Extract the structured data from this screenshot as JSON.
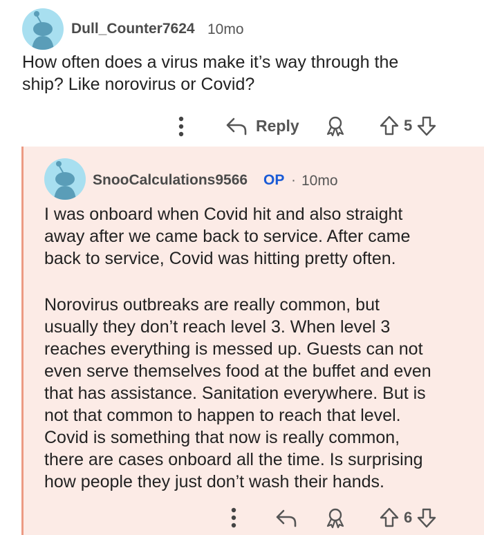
{
  "comment": {
    "username": "Dull_Counter7624",
    "time": "10mo",
    "body": "How often does a virus make it’s way through the\nship? Like norovirus or Covid?",
    "reply_label": "Reply",
    "vote_count": "5"
  },
  "reply": {
    "username": "SnooCalculations9566",
    "op_badge": "OP",
    "separator": "·",
    "time": "10mo",
    "body_p1": "I was onboard when Covid hit and also straight\naway after we came back to service. After came\nback to service, Covid was hitting pretty often.",
    "body_p2": "Norovirus outbreaks are really common, but\nusually they don’t reach level 3. When level 3\nreaches everything is messed up. Guests can not\neven serve themselves food at the buffet and even\nthat has assistance. Sanitation everywhere. But is\nnot that common to happen to reach that level.\nCovid is something that now is really common,\nthere are cases onboard all the time. Is surprising\nhow people they just don’t wash their hands.",
    "vote_count": "6"
  },
  "icons": [
    "more-vertical-icon",
    "reply-arrow-icon",
    "award-icon",
    "upvote-arrow-icon",
    "downvote-arrow-icon"
  ],
  "colors": {
    "reply_background": "#fcebe6",
    "thread_line": "#ec9a83",
    "op_badge": "#1a5bd6",
    "avatar_bg": "#a8dff0"
  }
}
